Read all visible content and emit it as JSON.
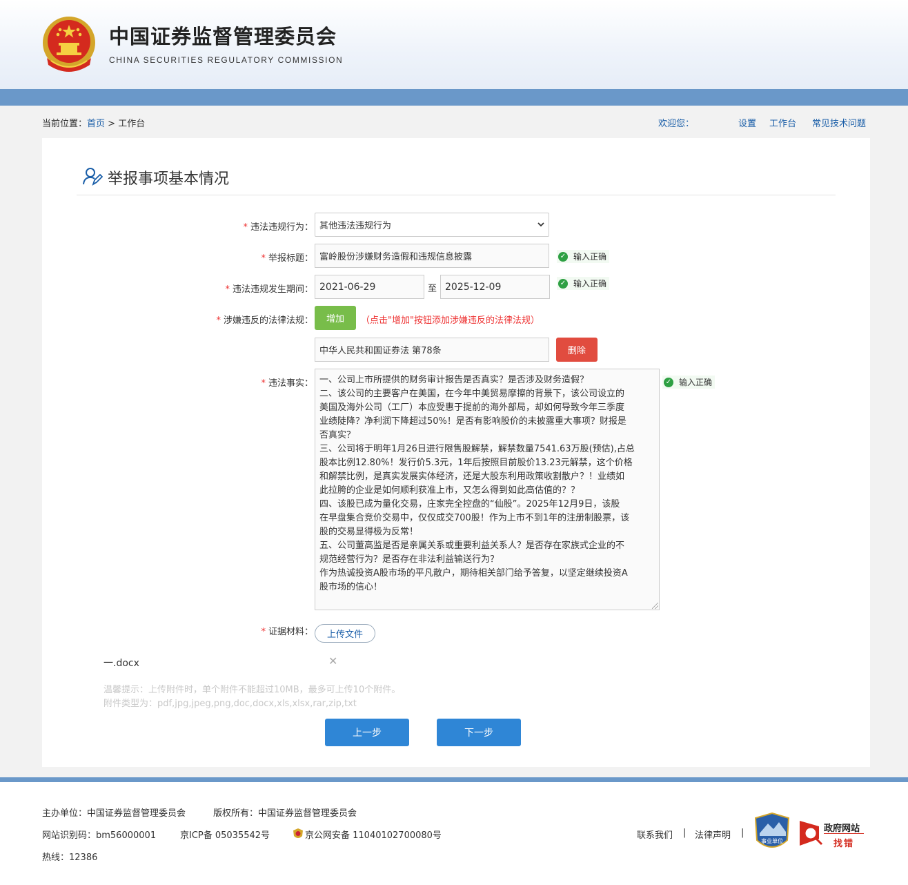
{
  "header": {
    "title_cn": "中国证券监督管理委员会",
    "title_en": "CHINA SECURITIES REGULATORY COMMISSION"
  },
  "breadcrumb": {
    "prefix": "当前位置：",
    "home": "首页",
    "sep": " > ",
    "current": "工作台"
  },
  "topnav": {
    "welcome": "欢迎您：",
    "settings": "设置",
    "workbench": "工作台",
    "faq": "常见技术问题"
  },
  "form": {
    "section_title": "举报事项基本情况",
    "violation_type": {
      "label": "违法违规行为：",
      "value": "其他违法违规行为"
    },
    "report_title": {
      "label": "举报标题：",
      "value": "富岭股份涉嫌财务造假和违规信息披露",
      "status": "输入正确"
    },
    "period": {
      "label": "违法违规发生期间：",
      "start": "2021-06-29",
      "to": "至",
      "end": "2025-12-09",
      "status": "输入正确"
    },
    "laws": {
      "label": "涉嫌违反的法律法规：",
      "add_button": "增加",
      "hint": "（点击\"增加\"按钮添加涉嫌违反的法律法规）",
      "law_value": "中华人民共和国证券法 第78条",
      "delete_button": "删除"
    },
    "facts": {
      "label": "违法事实：",
      "status": "输入正确",
      "lines": [
        "一、公司上市所提供的财务审计报告是否真实？是否涉及财务造假？",
        "二、该公司的主要客户在美国，在今年中美贸易摩擦的背景下，该公司设立的",
        "美国及海外公司（工厂）本应受惠于提前的海外部局，却如何导致今年三季度",
        "业绩陡降？净利润下降超过50%！是否有影响股价的未披露重大事项？财报是",
        "否真实？",
        "三、公司将于明年1月26日进行限售股解禁，解禁数量7541.63万股(预估),占总",
        "股本比例12.80%！发行价5.3元，1年后按照目前股价13.23元解禁，这个价格",
        "和解禁比例，是真实发展实体经济，还是大股东利用政策收割散户？！业绩如",
        "此拉胯的企业是如何顺利获准上市，又怎么得到如此高估值的？？",
        "四、该股已成为量化交易，庄家完全控盘的“仙股”。2025年12月9日，该股",
        "在早盘集合竞价交易中，仅仅成交700股！作为上市不到1年的注册制股票，该",
        "股的交易显得极为反常！",
        "五、公司董高监是否是亲属关系或重要利益关系人？是否存在家族式企业的不",
        "规范经营行为？是否存在非法利益输送行为？",
        "作为热诚投资A股市场的平凡散户，期待相关部门给予答复，以坚定继续投资A",
        "股市场的信心！"
      ]
    },
    "evidence": {
      "label": "证据材料：",
      "upload_button": "上传文件",
      "file_name": "一.docx",
      "remove": "✕",
      "tip1": "温馨提示：上传附件时，单个附件不能超过10MB，最多可上传10个附件。",
      "tip2": "附件类型为：pdf,jpg,jpeg,png,doc,docx,xls,xlsx,rar,zip,txt"
    },
    "prev_button": "上一步",
    "next_button": "下一步",
    "required_mark": "*"
  },
  "footer": {
    "host": "主办单位：中国证券监督管理委员会",
    "copyright": "版权所有：中国证券监督管理委员会",
    "site_id": "网站识别码：bm56000001",
    "icp": "京ICP备 05035542号",
    "police": "京公网安备 11040102700080号",
    "hotline": "热线：12386",
    "contact": "联系我们",
    "sep": "|",
    "legal": "法律声明",
    "badge_text": "事业单位",
    "gov_text1": "政府网站",
    "gov_text2": "找错"
  },
  "colors": {
    "accent_blue": "#6a98c9",
    "link": "#1a5ea8",
    "add_green": "#78bd4a",
    "delete_red": "#e14c3f",
    "primary_button": "#2f86d6"
  }
}
